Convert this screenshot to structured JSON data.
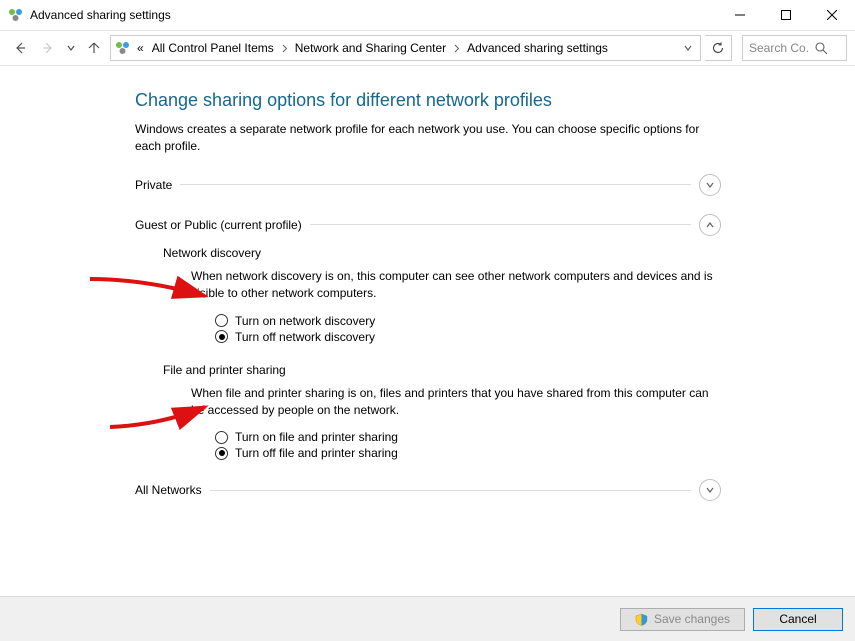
{
  "window": {
    "title": "Advanced sharing settings"
  },
  "breadcrumbs": {
    "pre": "«",
    "items": [
      "All Control Panel Items",
      "Network and Sharing Center",
      "Advanced sharing settings"
    ]
  },
  "search": {
    "placeholder": "Search Co..."
  },
  "page": {
    "heading": "Change sharing options for different network profiles",
    "subheading": "Windows creates a separate network profile for each network you use. You can choose specific options for each profile."
  },
  "sections": {
    "private": {
      "label": "Private"
    },
    "guest": {
      "label": "Guest or Public (current profile)",
      "network_discovery": {
        "title": "Network discovery",
        "desc": "When network discovery is on, this computer can see other network computers and devices and is visible to other network computers.",
        "opt_on": "Turn on network discovery",
        "opt_off": "Turn off network discovery"
      },
      "file_printer": {
        "title": "File and printer sharing",
        "desc": "When file and printer sharing is on, files and printers that you have shared from this computer can be accessed by people on the network.",
        "opt_on": "Turn on file and printer sharing",
        "opt_off": "Turn off file and printer sharing"
      }
    },
    "all_networks": {
      "label": "All Networks"
    }
  },
  "buttons": {
    "save": "Save changes",
    "cancel": "Cancel"
  }
}
